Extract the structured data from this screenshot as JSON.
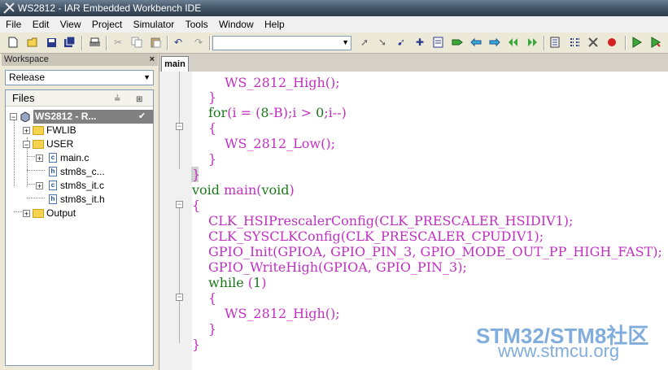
{
  "window": {
    "title": "WS2812 - IAR Embedded Workbench IDE"
  },
  "menu": [
    "File",
    "Edit",
    "View",
    "Project",
    "Simulator",
    "Tools",
    "Window",
    "Help"
  ],
  "workspace": {
    "header": "Workspace",
    "close": "×",
    "configuration": "Release",
    "files_header": "Files",
    "tree": {
      "project": "WS2812 - R...",
      "project_check": "✔",
      "fwlib": "FWLIB",
      "user": "USER",
      "main_c": "main.c",
      "stm8s_c": "stm8s_c...",
      "stm8s_it_c": "stm8s_it.c",
      "stm8s_it_h": "stm8s_it.h",
      "output": "Output"
    }
  },
  "editor": {
    "tab": "main",
    "lines": [
      "WS_2812_High();",
      "}",
      "for(i = (8-B);i > 0;i--)",
      "{",
      "WS_2812_Low();",
      "}",
      "}",
      "void main(void)",
      "{",
      "CLK_HSIPrescalerConfig(CLK_PRESCALER_HSIDIV1);",
      "CLK_SYSCLKConfig(CLK_PRESCALER_CPUDIV1);",
      "GPIO_Init(GPIOA, GPIO_PIN_3, GPIO_MODE_OUT_PP_HIGH_FAST);",
      "GPIO_WriteHigh(GPIOA, GPIO_PIN_3);",
      "while (1)",
      "{",
      "WS_2812_High();",
      "}",
      "}"
    ]
  },
  "watermark": {
    "line1": "STM32/STM8社区",
    "line2": "www.stmcu.org"
  },
  "colors": {
    "keyword": "#1a7a1a",
    "identifier": "#c030c0",
    "watermark": "#6a9fd6"
  }
}
